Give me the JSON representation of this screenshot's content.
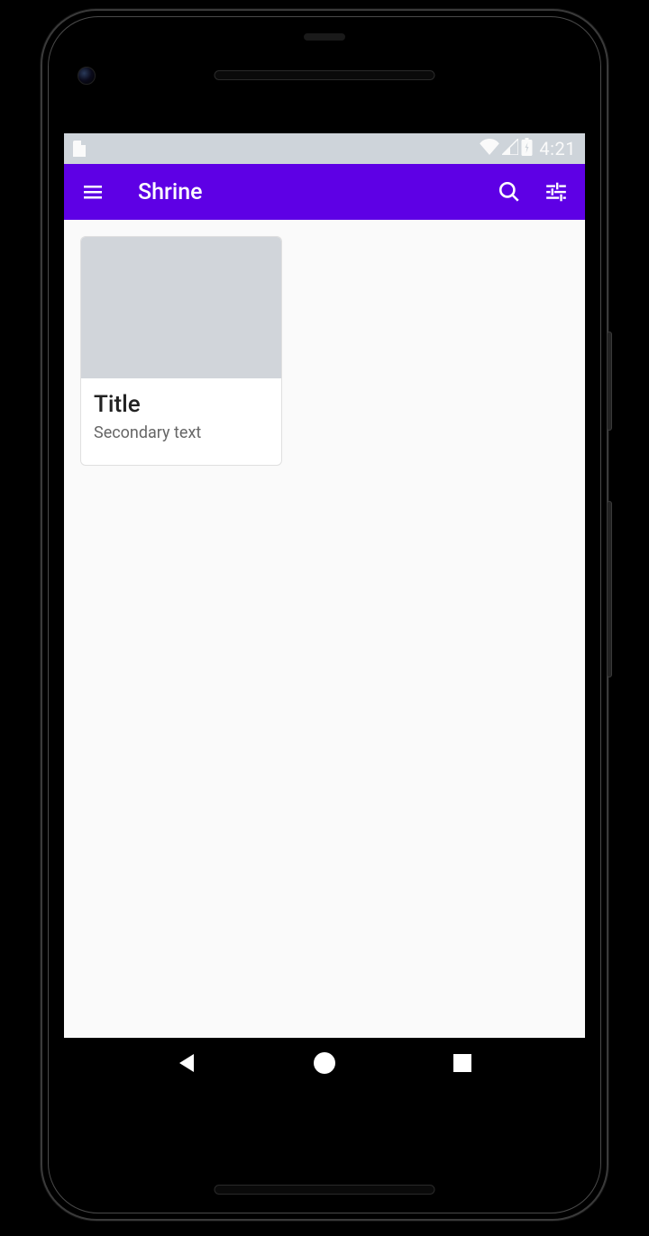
{
  "statusbar": {
    "clock": "4:21"
  },
  "appbar": {
    "title": "Shrine",
    "colors": {
      "primary": "#5e00e5"
    }
  },
  "icons": {
    "menu": "menu-icon",
    "search": "search-icon",
    "tune": "tune-icon",
    "sd_card": "sd-card-icon",
    "wifi": "wifi-icon",
    "cellular": "cell-signal-icon",
    "battery": "battery-charging-icon",
    "back": "back-triangle-icon",
    "home": "home-circle-icon",
    "recents": "recents-square-icon"
  },
  "cards": [
    {
      "title": "Title",
      "secondary": "Secondary text"
    }
  ]
}
